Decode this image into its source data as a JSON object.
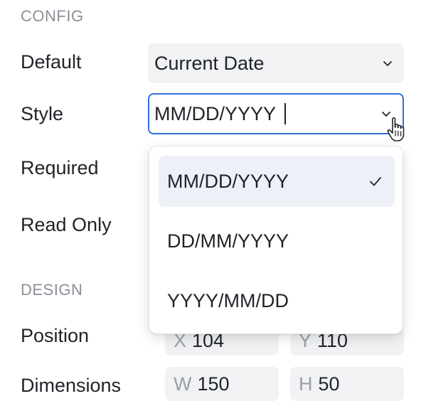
{
  "sections": {
    "config_title": "CONFIG",
    "design_title": "DESIGN"
  },
  "config": {
    "default_label": "Default",
    "default_value": "Current Date",
    "style_label": "Style",
    "style_value": "MM/DD/YYYY",
    "required_label": "Required",
    "read_only_label": "Read Only"
  },
  "design": {
    "position_label": "Position",
    "x_axis": "X",
    "x_value": "104",
    "y_axis": "Y",
    "y_value": "110",
    "dimensions_label": "Dimensions",
    "w_axis": "W",
    "w_value": "150",
    "h_axis": "H",
    "h_value": "50"
  },
  "dropdown": {
    "options": [
      {
        "label": "MM/DD/YYYY",
        "selected": true
      },
      {
        "label": "DD/MM/YYYY",
        "selected": false
      },
      {
        "label": "YYYY/MM/DD",
        "selected": false
      }
    ]
  },
  "colors": {
    "focus_border": "#2f6fdd",
    "field_bg": "#f1f2f4",
    "selected_option_bg": "#edf0f7",
    "section_title": "#8b8f96"
  },
  "icons": [
    "chevron-down-icon",
    "check-icon",
    "hand-pointer-icon"
  ]
}
